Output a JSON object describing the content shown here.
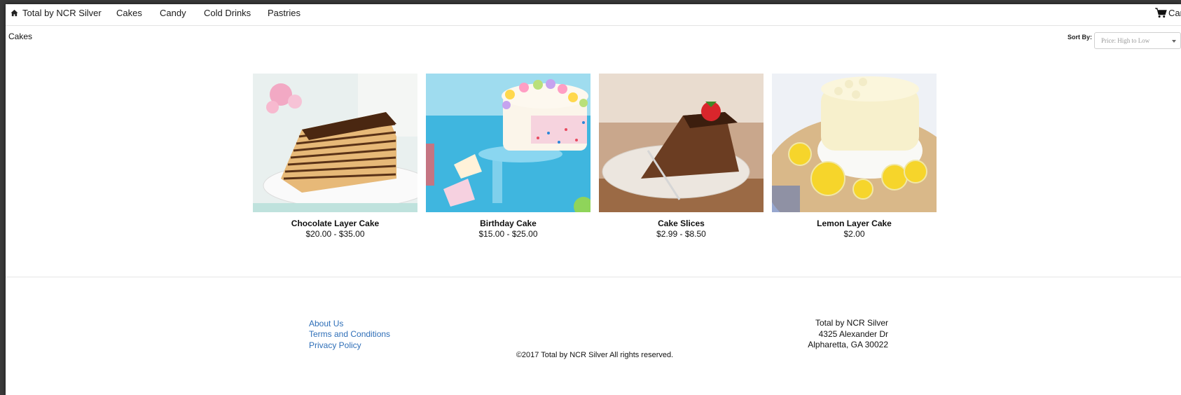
{
  "nav": {
    "brand": "Total by NCR Silver",
    "links": [
      "Cakes",
      "Candy",
      "Cold Drinks",
      "Pastries"
    ],
    "cart": "Car"
  },
  "page": {
    "heading": "Cakes",
    "sort_label": "Sort By:",
    "sort_value": "Price: High to Low"
  },
  "products": [
    {
      "name": "Chocolate Layer Cake",
      "price": "$20.00 - $35.00"
    },
    {
      "name": "Birthday Cake",
      "price": "$15.00 - $25.00"
    },
    {
      "name": "Cake Slices",
      "price": "$2.99 - $8.50"
    },
    {
      "name": "Lemon Layer Cake",
      "price": "$2.00"
    }
  ],
  "footer": {
    "links": [
      "About Us",
      "Terms and Conditions",
      "Privacy Policy"
    ],
    "copyright": "©2017 Total by NCR Silver All rights reserved.",
    "address": [
      "Total by NCR Silver",
      "4325 Alexander Dr",
      "Alpharetta, GA 30022"
    ]
  },
  "colors": {
    "link": "#2f6fb8",
    "text": "#111111"
  }
}
